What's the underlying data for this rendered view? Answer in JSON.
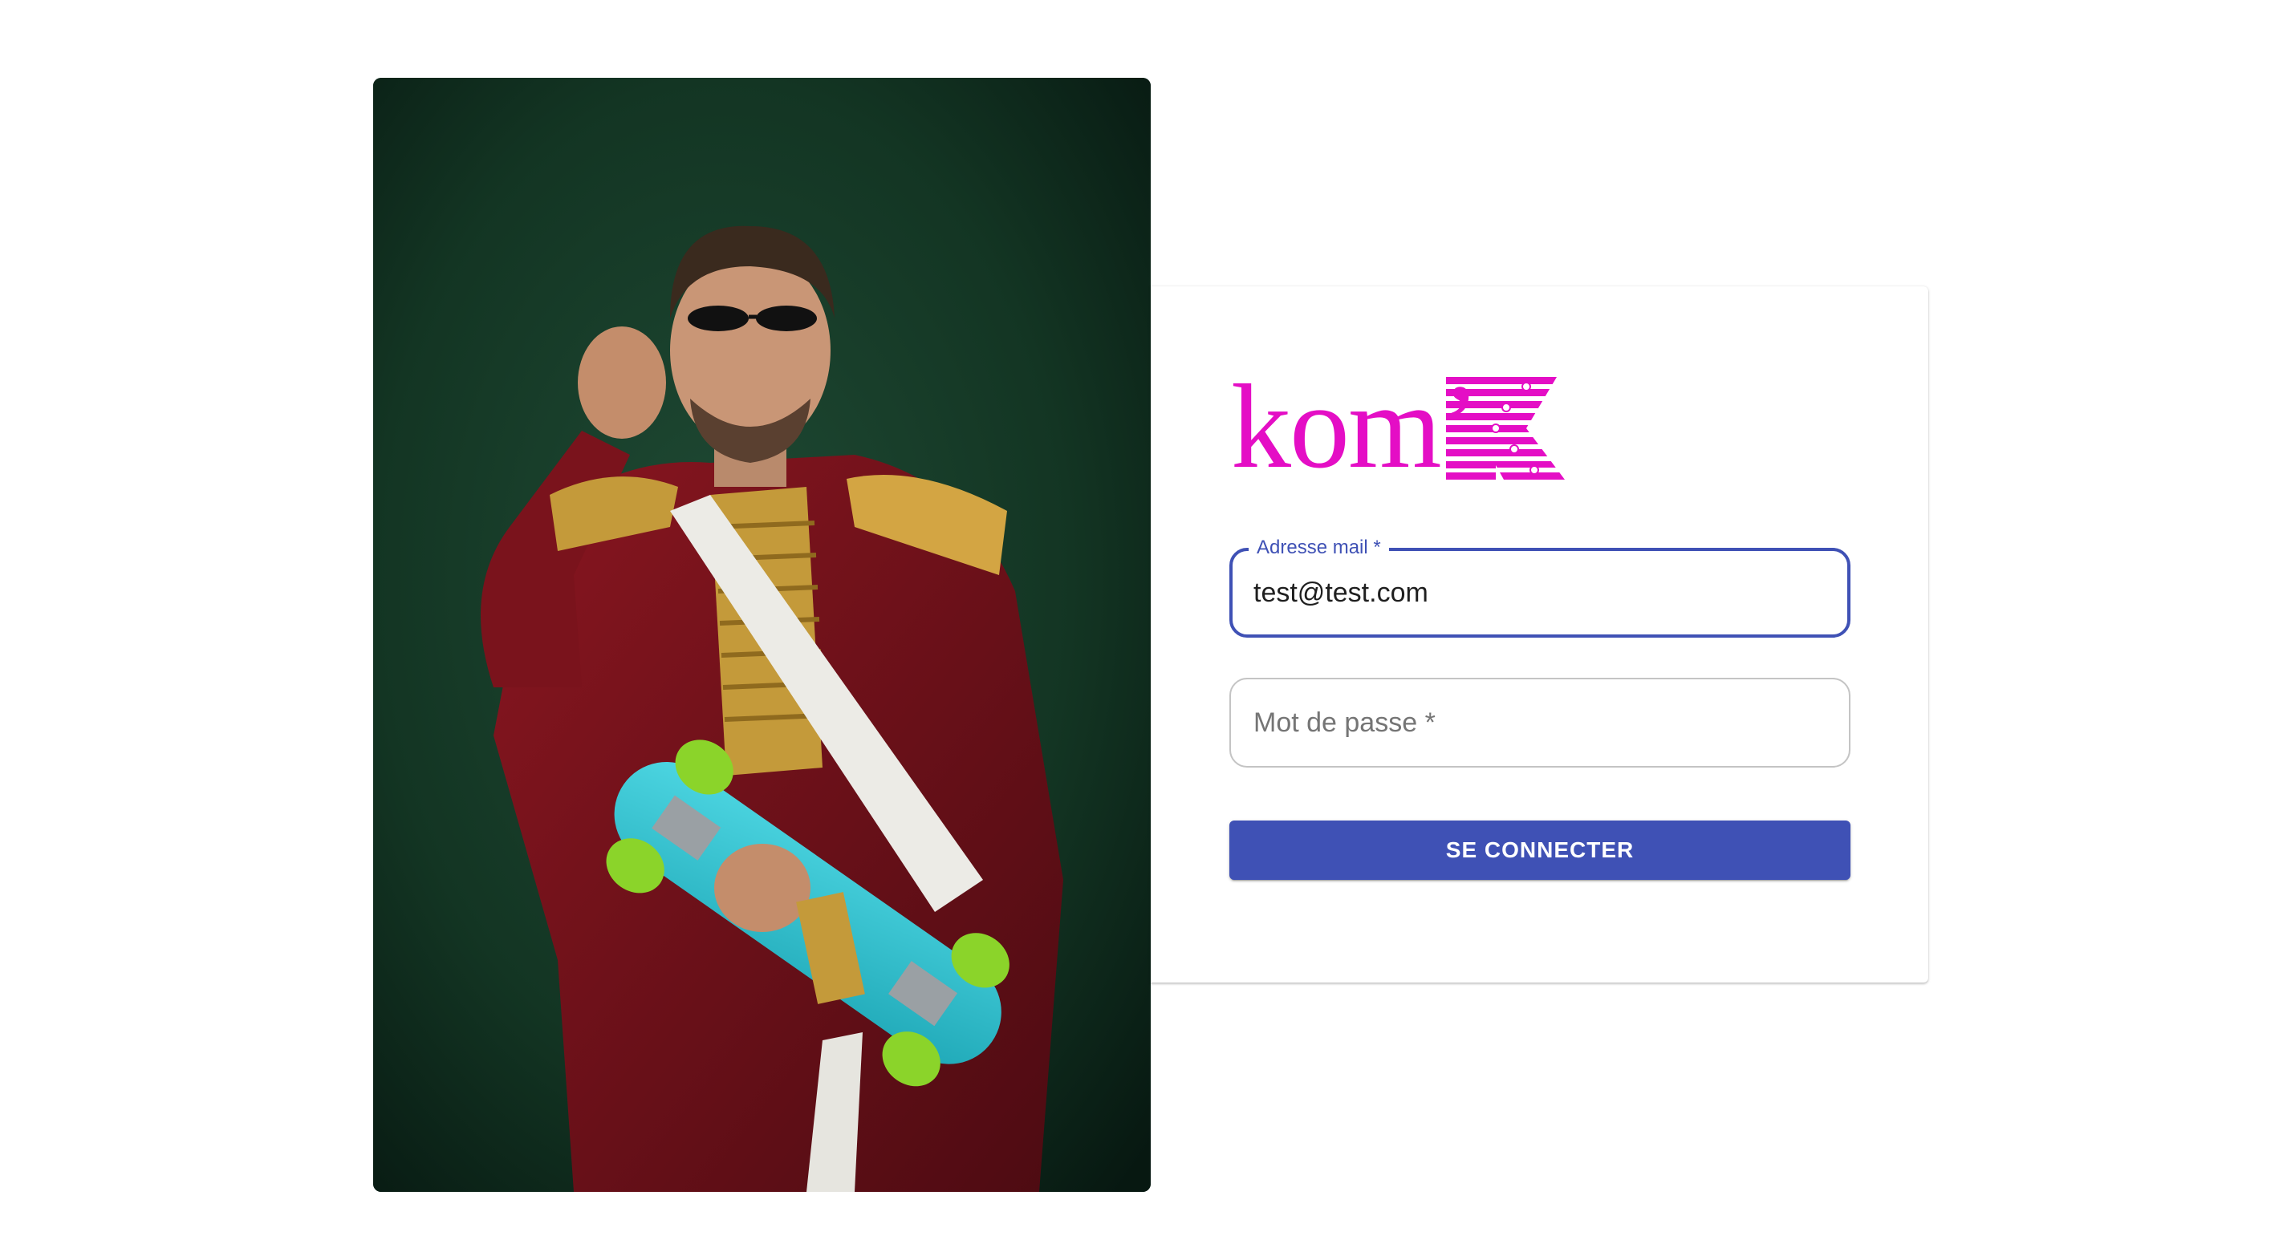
{
  "login": {
    "logo_text": "kom’",
    "email_label": "Adresse mail *",
    "email_value": "test@test.com",
    "password_placeholder": "Mot de passe *",
    "submit_label": "SE CONNECTER"
  },
  "colors": {
    "brand_magenta": "#e40ec5",
    "primary": "#3f51b5",
    "field_border": "#c4c4c4"
  }
}
